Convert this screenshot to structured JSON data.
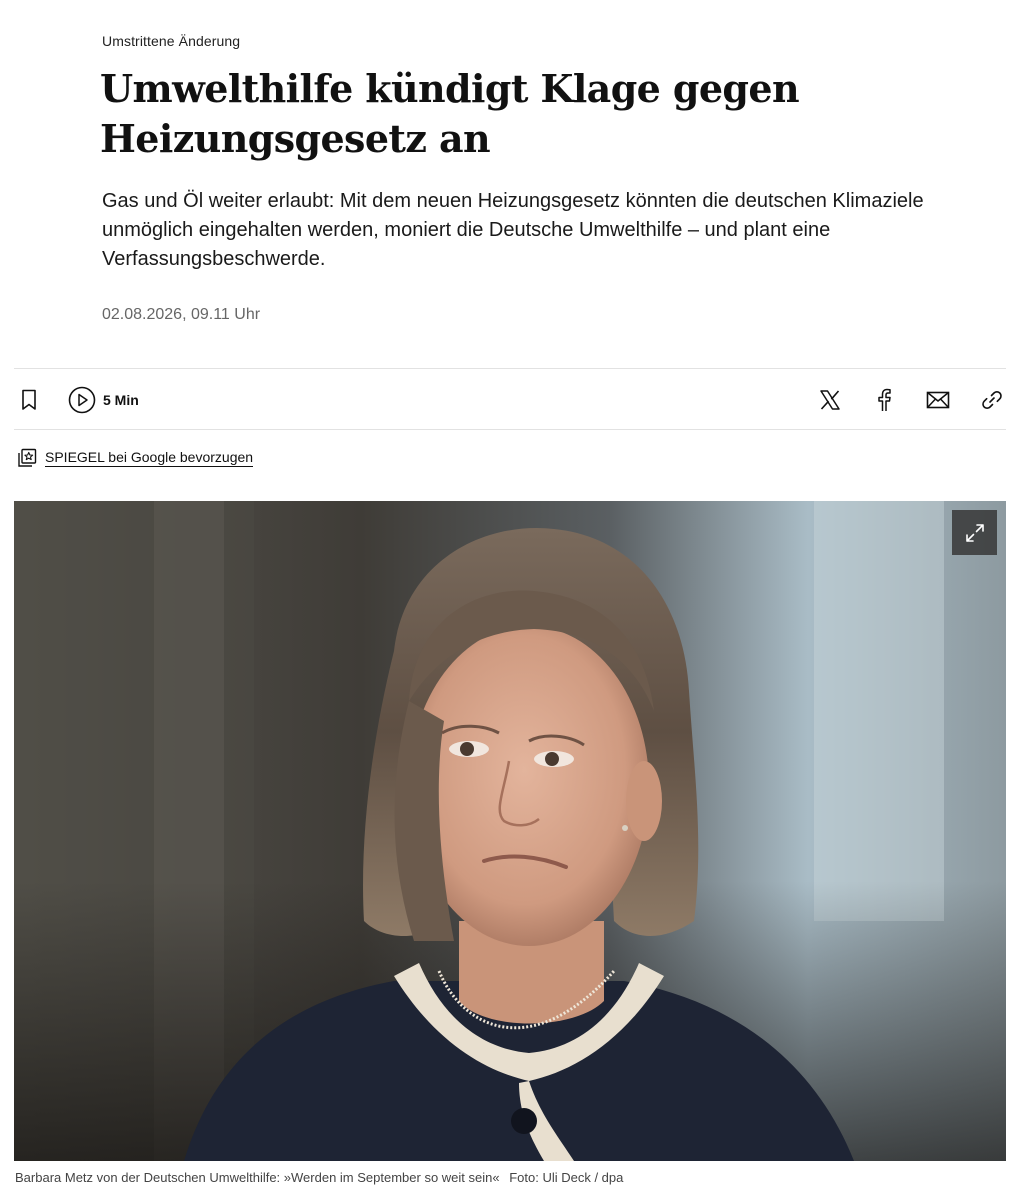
{
  "article": {
    "kicker": "Umstrittene Änderung",
    "headline_line1": "Umwelthilfe kündigt Klage gegen",
    "headline_line2": "Heizungsgesetz an",
    "lead": "Gas und Öl weiter erlaubt: Mit dem neuen Heizungsgesetz könnten die deutschen Klimaziele unmöglich eingehalten werden, moniert die Deutsche Umwelthilfe – und plant eine Verfassungsbeschwerde.",
    "date": "02.08.2026, 09.11 Uhr"
  },
  "toolbar": {
    "listen_label": "5 Min",
    "icons": [
      "bookmark-icon",
      "play-icon",
      "x-logo-icon",
      "facebook-icon",
      "mail-icon",
      "link-icon"
    ]
  },
  "google_pref": {
    "label": "SPIEGEL bei Google bevorzugen",
    "icon": "star-stack-icon"
  },
  "photo": {
    "caption": "Barbara Metz von der Deutschen Umwelthilfe: »Werden im September so weit sein«",
    "credit": "Foto: Uli Deck / dpa",
    "expand_icon": "expand-icon"
  }
}
